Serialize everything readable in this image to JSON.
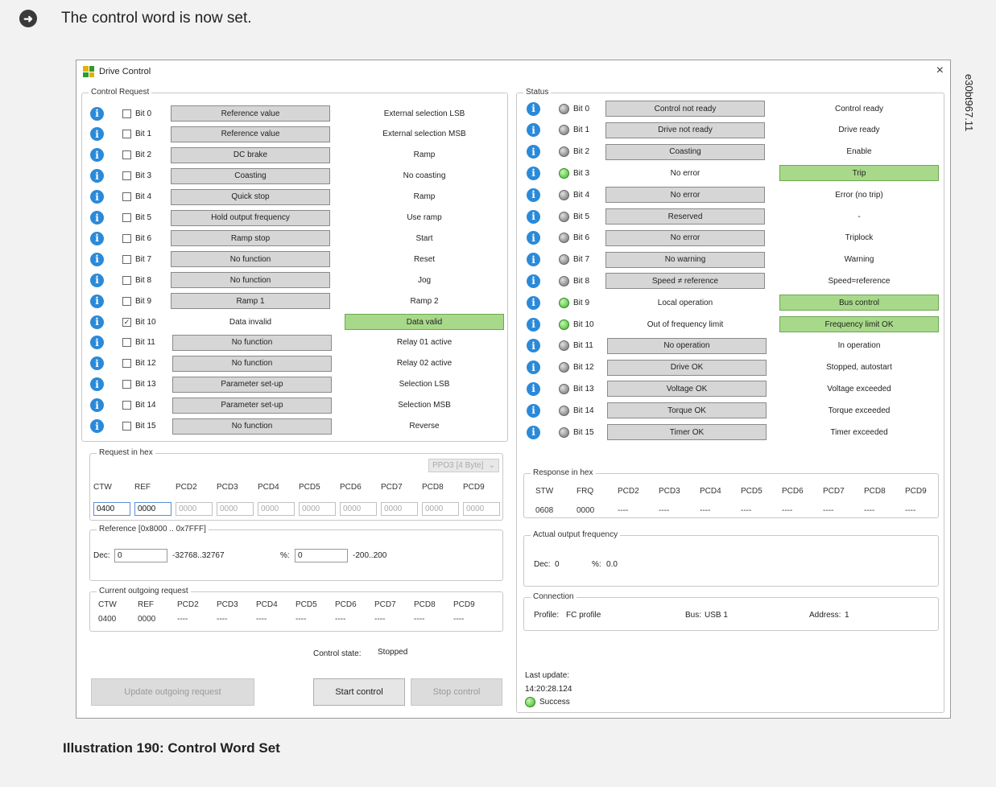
{
  "topnote": "The control word is now set.",
  "caption": "Illustration 190: Control Word Set",
  "sidecode": "e30bt967.11",
  "window": {
    "title": "Drive Control",
    "close": "×"
  },
  "control_request": {
    "title": "Control Request",
    "rows": [
      {
        "bit": "Bit 0",
        "checked": false,
        "left": "Reference value",
        "right": "External selection LSB",
        "active": "left"
      },
      {
        "bit": "Bit 1",
        "checked": false,
        "left": "Reference value",
        "right": "External selection MSB",
        "active": "left"
      },
      {
        "bit": "Bit 2",
        "checked": false,
        "left": "DC brake",
        "right": "Ramp",
        "active": "left"
      },
      {
        "bit": "Bit 3",
        "checked": false,
        "left": "Coasting",
        "right": "No coasting",
        "active": "left"
      },
      {
        "bit": "Bit 4",
        "checked": false,
        "left": "Quick stop",
        "right": "Ramp",
        "active": "left"
      },
      {
        "bit": "Bit 5",
        "checked": false,
        "left": "Hold output frequency",
        "right": "Use ramp",
        "active": "left"
      },
      {
        "bit": "Bit 6",
        "checked": false,
        "left": "Ramp stop",
        "right": "Start",
        "active": "left"
      },
      {
        "bit": "Bit 7",
        "checked": false,
        "left": "No function",
        "right": "Reset",
        "active": "left"
      },
      {
        "bit": "Bit 8",
        "checked": false,
        "left": "No function",
        "right": "Jog",
        "active": "left"
      },
      {
        "bit": "Bit 9",
        "checked": false,
        "left": "Ramp 1",
        "right": "Ramp 2",
        "active": "left"
      },
      {
        "bit": "Bit 10",
        "checked": true,
        "left": "Data invalid",
        "right": "Data valid",
        "active": "right"
      },
      {
        "bit": "Bit 11",
        "checked": false,
        "left": "No function",
        "right": "Relay 01 active",
        "active": "left"
      },
      {
        "bit": "Bit 12",
        "checked": false,
        "left": "No function",
        "right": "Relay 02 active",
        "active": "left"
      },
      {
        "bit": "Bit 13",
        "checked": false,
        "left": "Parameter set-up",
        "right": "Selection LSB",
        "active": "left"
      },
      {
        "bit": "Bit 14",
        "checked": false,
        "left": "Parameter set-up",
        "right": "Selection MSB",
        "active": "left"
      },
      {
        "bit": "Bit 15",
        "checked": false,
        "left": "No function",
        "right": "Reverse",
        "active": "left"
      }
    ]
  },
  "request_hex": {
    "title": "Request in hex",
    "dropdown": "PPO3 [4 Byte]",
    "headers": [
      "CTW",
      "REF",
      "PCD2",
      "PCD3",
      "PCD4",
      "PCD5",
      "PCD6",
      "PCD7",
      "PCD8",
      "PCD9"
    ],
    "values": [
      "0400",
      "0000",
      "0000",
      "0000",
      "0000",
      "0000",
      "0000",
      "0000",
      "0000",
      "0000"
    ]
  },
  "reference": {
    "title": "Reference [0x8000 .. 0x7FFF]",
    "dec_label": "Dec:",
    "dec_value": "0",
    "dec_range": "-32768..32767",
    "pct_label": "%:",
    "pct_value": "0",
    "pct_range": "-200..200"
  },
  "current_outgoing": {
    "title": "Current outgoing request",
    "headers": [
      "CTW",
      "REF",
      "PCD2",
      "PCD3",
      "PCD4",
      "PCD5",
      "PCD6",
      "PCD7",
      "PCD8",
      "PCD9"
    ],
    "values": [
      "0400",
      "0000",
      "----",
      "----",
      "----",
      "----",
      "----",
      "----",
      "----",
      "----"
    ]
  },
  "control_state": {
    "label": "Control state:",
    "value": "Stopped"
  },
  "buttons": {
    "update": "Update outgoing request",
    "start": "Start control",
    "stop": "Stop control"
  },
  "status": {
    "title": "Status",
    "rows": [
      {
        "bit": "Bit 0",
        "on": false,
        "left": "Control not ready",
        "right": "Control ready",
        "active": "left"
      },
      {
        "bit": "Bit 1",
        "on": false,
        "left": "Drive not ready",
        "right": "Drive ready",
        "active": "left"
      },
      {
        "bit": "Bit 2",
        "on": false,
        "left": "Coasting",
        "right": "Enable",
        "active": "left"
      },
      {
        "bit": "Bit 3",
        "on": true,
        "left": "No error",
        "right": "Trip",
        "active": "right"
      },
      {
        "bit": "Bit 4",
        "on": false,
        "left": "No error",
        "right": "Error (no trip)",
        "active": "left"
      },
      {
        "bit": "Bit 5",
        "on": false,
        "left": "Reserved",
        "right": "-",
        "active": "left"
      },
      {
        "bit": "Bit 6",
        "on": false,
        "left": "No error",
        "right": "Triplock",
        "active": "left"
      },
      {
        "bit": "Bit 7",
        "on": false,
        "left": "No warning",
        "right": "Warning",
        "active": "left"
      },
      {
        "bit": "Bit 8",
        "on": false,
        "left": "Speed ≠ reference",
        "right": "Speed=reference",
        "active": "left"
      },
      {
        "bit": "Bit 9",
        "on": true,
        "left": "Local operation",
        "right": "Bus control",
        "active": "right"
      },
      {
        "bit": "Bit 10",
        "on": true,
        "left": "Out of frequency limit",
        "right": "Frequency limit OK",
        "active": "right"
      },
      {
        "bit": "Bit 11",
        "on": false,
        "left": "No operation",
        "right": "In operation",
        "active": "left"
      },
      {
        "bit": "Bit 12",
        "on": false,
        "left": "Drive OK",
        "right": "Stopped, autostart",
        "active": "left"
      },
      {
        "bit": "Bit 13",
        "on": false,
        "left": "Voltage OK",
        "right": "Voltage exceeded",
        "active": "left"
      },
      {
        "bit": "Bit 14",
        "on": false,
        "left": "Torque OK",
        "right": "Torque exceeded",
        "active": "left"
      },
      {
        "bit": "Bit 15",
        "on": false,
        "left": "Timer OK",
        "right": "Timer exceeded",
        "active": "left"
      }
    ]
  },
  "response_hex": {
    "title": "Response in hex",
    "headers": [
      "STW",
      "FRQ",
      "PCD2",
      "PCD3",
      "PCD4",
      "PCD5",
      "PCD6",
      "PCD7",
      "PCD8",
      "PCD9"
    ],
    "values": [
      "0608",
      "0000",
      "----",
      "----",
      "----",
      "----",
      "----",
      "----",
      "----",
      "----"
    ]
  },
  "actual_freq": {
    "title": "Actual output frequency",
    "dec_label": "Dec:",
    "dec_value": "0",
    "pct_label": "%:",
    "pct_value": "0.0"
  },
  "connection": {
    "title": "Connection",
    "profile_label": "Profile:",
    "profile": "FC profile",
    "bus_label": "Bus:",
    "bus": "USB 1",
    "address_label": "Address:",
    "address": "1"
  },
  "last_update": {
    "label": "Last update:",
    "time": "14:20:28.124",
    "status": "Success"
  },
  "colors": {
    "green": "#a8d98a",
    "gray": "#d6d6d6",
    "info": "#2b8ad8"
  }
}
